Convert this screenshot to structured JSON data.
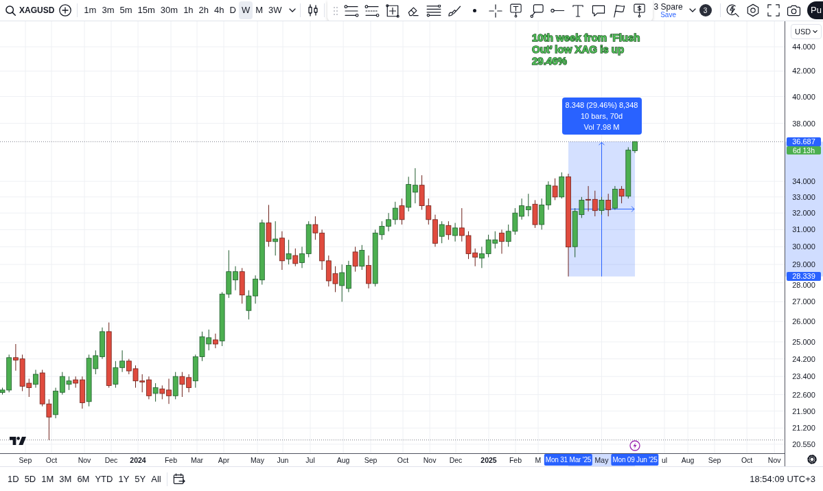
{
  "toolbar": {
    "symbol": "XAGUSD",
    "intervals": [
      {
        "label": "1m",
        "selected": false
      },
      {
        "label": "3m",
        "selected": false
      },
      {
        "label": "5m",
        "selected": false
      },
      {
        "label": "15m",
        "selected": false
      },
      {
        "label": "30m",
        "selected": false
      },
      {
        "label": "1h",
        "selected": false
      },
      {
        "label": "2h",
        "selected": false
      },
      {
        "label": "4h",
        "selected": false
      },
      {
        "label": "D",
        "selected": false
      },
      {
        "label": "W",
        "selected": true
      },
      {
        "label": "M",
        "selected": false
      },
      {
        "label": "3W",
        "selected": false
      }
    ],
    "layout_name": "3 Spare",
    "save_label": "Save",
    "badge": "3",
    "button": "Pu"
  },
  "chart": {
    "currency": "USD",
    "annotation": "10th week from ‘Flush Out’ low XAG is up 29.46%",
    "countdown": "6d 13h",
    "measurement": {
      "lines": [
        "8.348 (29.46%) 8,348",
        "10 bars, 70d",
        "Vol 7.98 M"
      ],
      "top_price": "36.687",
      "bottom_price": "28.339",
      "start_date": "Mon 31 Mar '25",
      "end_date": "Mon 09 Jun '25"
    },
    "price_axis": [
      "44.000",
      "42.000",
      "40.000",
      "38.000",
      "34.000",
      "33.000",
      "32.000",
      "31.000",
      "30.000",
      "29.000",
      "28.000",
      "27.000",
      "26.000",
      "25.000",
      "24.200",
      "23.400",
      "22.600",
      "21.900",
      "21.200",
      "20.550"
    ],
    "time_axis": [
      {
        "label": "Sep",
        "kind": "month"
      },
      {
        "label": "Oct",
        "kind": "month"
      },
      {
        "label": "Nov",
        "kind": "month"
      },
      {
        "label": "Dec",
        "kind": "month"
      },
      {
        "label": "2024",
        "kind": "year"
      },
      {
        "label": "Feb",
        "kind": "month"
      },
      {
        "label": "Mar",
        "kind": "month"
      },
      {
        "label": "Apr",
        "kind": "month"
      },
      {
        "label": "May",
        "kind": "month"
      },
      {
        "label": "Jun",
        "kind": "month"
      },
      {
        "label": "Jul",
        "kind": "month"
      },
      {
        "label": "Aug",
        "kind": "month"
      },
      {
        "label": "Sep",
        "kind": "month"
      },
      {
        "label": "Oct",
        "kind": "month"
      },
      {
        "label": "Nov",
        "kind": "month"
      },
      {
        "label": "Dec",
        "kind": "month"
      },
      {
        "label": "2025",
        "kind": "year"
      },
      {
        "label": "Feb",
        "kind": "month"
      },
      {
        "label": "M",
        "kind": "month"
      },
      {
        "label": "May",
        "kind": "month"
      },
      {
        "label": "ul",
        "kind": "month"
      },
      {
        "label": "Aug",
        "kind": "month"
      },
      {
        "label": "Sep",
        "kind": "month"
      },
      {
        "label": "Oct",
        "kind": "month"
      },
      {
        "label": "Nov",
        "kind": "month"
      }
    ]
  },
  "bottom_bar": {
    "ranges": [
      "1D",
      "5D",
      "1M",
      "3M",
      "6M",
      "YTD",
      "1Y",
      "5Y",
      "All"
    ],
    "clock": "18:54:09 UTC+3"
  }
}
